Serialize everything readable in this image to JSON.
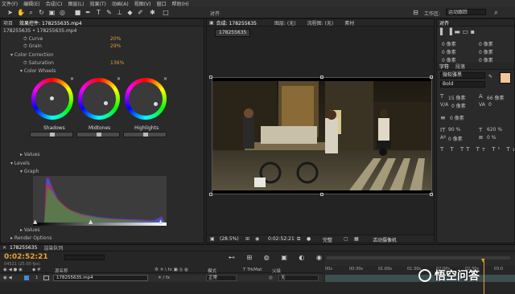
{
  "menu": [
    "文件(F)",
    "编辑(E)",
    "合成(C)",
    "图层(L)",
    "效果(T)",
    "动画(A)",
    "视图(V)",
    "窗口",
    "帮助(H)"
  ],
  "toolbar": {
    "align_label": "对齐",
    "workspace_label": "工作区:",
    "workspace_value": "运动跟踪"
  },
  "left_panel": {
    "tabs": [
      "项目",
      "效果控件: 178255635.mp4"
    ],
    "header1": "178255635 • 178255635.mp4",
    "rows": [
      {
        "label": "Curve",
        "value": "20%"
      },
      {
        "label": "Grain",
        "value": "29%"
      },
      {
        "label": "Color Correction",
        "value": ""
      },
      {
        "label": "Saturation",
        "value": "136%"
      },
      {
        "label": "Color Wheels",
        "value": ""
      }
    ],
    "wheels": [
      "Shadows",
      "Midtones",
      "Highlights"
    ],
    "values_label": "Values",
    "levels_label": "Levels",
    "graph_label": "Graph",
    "values2_label": "Values",
    "render_label": "Render Options"
  },
  "comp_panel": {
    "tabs": [
      "合成: 178255635",
      "图层: (无)",
      "流程图: (无)",
      "素材"
    ],
    "subtab": "178255635",
    "zoom": "(28.5%)",
    "timecode": "0:02:52:21",
    "quality": "完整",
    "camera": "活动摄像机"
  },
  "right_panel": {
    "align_tab": "对齐",
    "px_values": [
      "0 像素",
      "0 像素",
      "0 像素",
      "0 像素",
      "0 像素",
      "0 像素"
    ],
    "char_tab": "字符",
    "char_tab2": "段落",
    "font_name": "微软雅黑",
    "font_style": "Bold",
    "size_t": "15 像素",
    "size_a": "66 像素",
    "va1": "0 像素",
    "va2": "0",
    "pct1": "90 %",
    "pct2": "620 %",
    "pct3": "0 像素",
    "pct4": "0 %",
    "swatch_color": "#f2c79a"
  },
  "timeline": {
    "tabs": [
      "178255635",
      "渲染队列"
    ],
    "timecode": "0:02:52:21",
    "fps": "04521 (25.00 fps)",
    "cols": [
      "源名称",
      "模式",
      "T TrkMat",
      "父级"
    ],
    "layer_num": "1",
    "layer_name": "178255635.mp4",
    "mode": "正常",
    "parent": "无",
    "ruler": [
      "00s",
      "00:30s",
      "01:00s",
      "01:30s",
      "02:00s",
      "02:30s",
      "03:0"
    ]
  },
  "watermark": "悟空问答"
}
